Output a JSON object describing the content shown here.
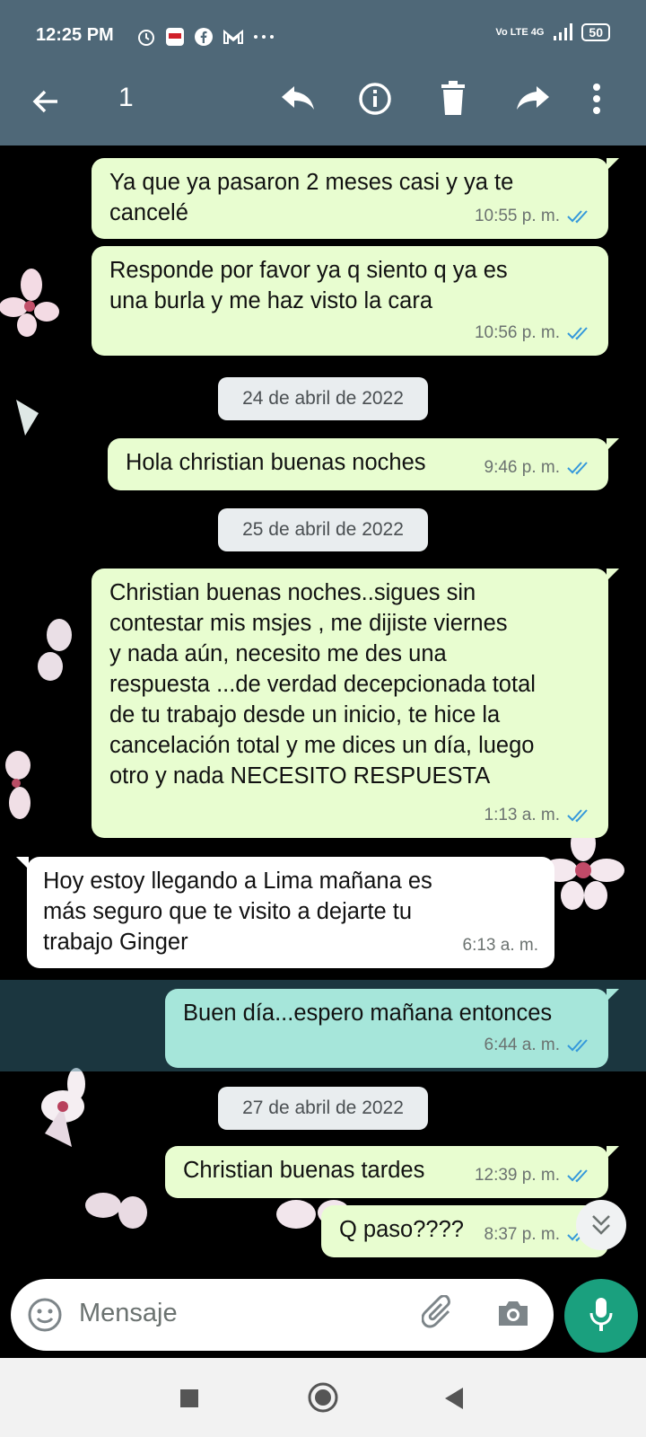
{
  "status_bar": {
    "time": "12:25 PM",
    "icons": [
      "alarm-icon",
      "clarin-app-icon",
      "facebook-icon",
      "gmail-icon",
      "more-dots-icon"
    ],
    "network": "Vo LTE 4G",
    "battery": "50"
  },
  "app_bar": {
    "selected_count": "1",
    "icons": [
      "back-arrow-icon",
      "reply-icon",
      "info-icon",
      "delete-icon",
      "forward-icon",
      "overflow-menu-icon"
    ]
  },
  "messages": [
    {
      "type": "out",
      "text": "Ya que ya pasaron 2 meses casi y ya te\ncancelé",
      "time": "10:55 p. m."
    },
    {
      "type": "out",
      "text": "Responde por favor ya q siento q ya es\nuna burla y me haz visto la cara",
      "time": "10:56 p. m."
    },
    {
      "type": "date",
      "text": "24 de abril de 2022"
    },
    {
      "type": "out",
      "text": "Hola christian buenas noches",
      "time": "9:46 p. m."
    },
    {
      "type": "date",
      "text": "25 de abril de 2022"
    },
    {
      "type": "out",
      "text": "Christian buenas noches..sigues sin\ncontestar mis msjes , me dijiste viernes\ny nada aún, necesito me des una\nrespuesta ...de verdad decepcionada total\nde tu trabajo desde un inicio, te hice la\ncancelación total y me dices un día, luego\notro y nada  NECESITO RESPUESTA",
      "time": "1:13 a. m."
    },
    {
      "type": "in",
      "text": "Hoy estoy llegando a Lima mañana es\nmás seguro que te visito a dejarte tu\ntrabajo Ginger",
      "time": "6:13 a. m."
    },
    {
      "type": "out",
      "text": "Buen día...espero mañana entonces",
      "time": "6:44 a. m.",
      "selected": true
    },
    {
      "type": "date",
      "text": "27 de abril de 2022"
    },
    {
      "type": "out",
      "text": "Christian buenas tardes",
      "time": "12:39 p. m."
    },
    {
      "type": "out",
      "text": "Q paso????",
      "time": "8:37 p. m."
    }
  ],
  "input": {
    "placeholder": "Mensaje"
  },
  "colors": {
    "app_bar": "#4f6878",
    "outgoing_bubble": "#e8fdd0",
    "incoming_bubble": "#ffffff",
    "selected_bubble": "#a6e6da",
    "read_ticks": "#3498db",
    "mic_button": "#1aa07e"
  }
}
